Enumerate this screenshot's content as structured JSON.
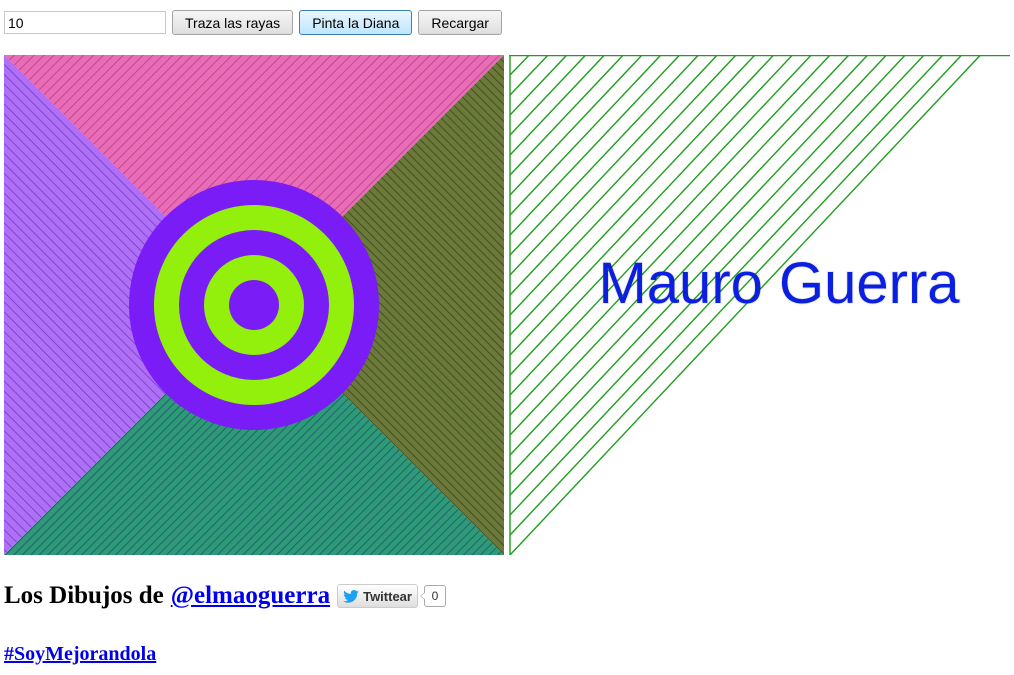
{
  "controls": {
    "lines_input_value": "10",
    "trace_button": "Traza las rayas",
    "target_button": "Pinta la Diana",
    "reload_button": "Recargar"
  },
  "drawing": {
    "title_text": "Mauro Guerra",
    "title_color": "#0a1fe0",
    "string_art_color": "#1e9e1e",
    "quadrant_colors": {
      "top": "#e060b0",
      "right": "#556b2f",
      "bottom": "#2a8a6a",
      "left": "#a050f0"
    },
    "target_ring_colors": [
      "#7a1cf5",
      "#93ef0c"
    ]
  },
  "footer": {
    "heading_text": "Los Dibujos de",
    "twitter_handle": "@elmaoguerra",
    "tweet_button": "Twittear",
    "tweet_count": "0",
    "hashtag": "#SoyMejorandola"
  }
}
